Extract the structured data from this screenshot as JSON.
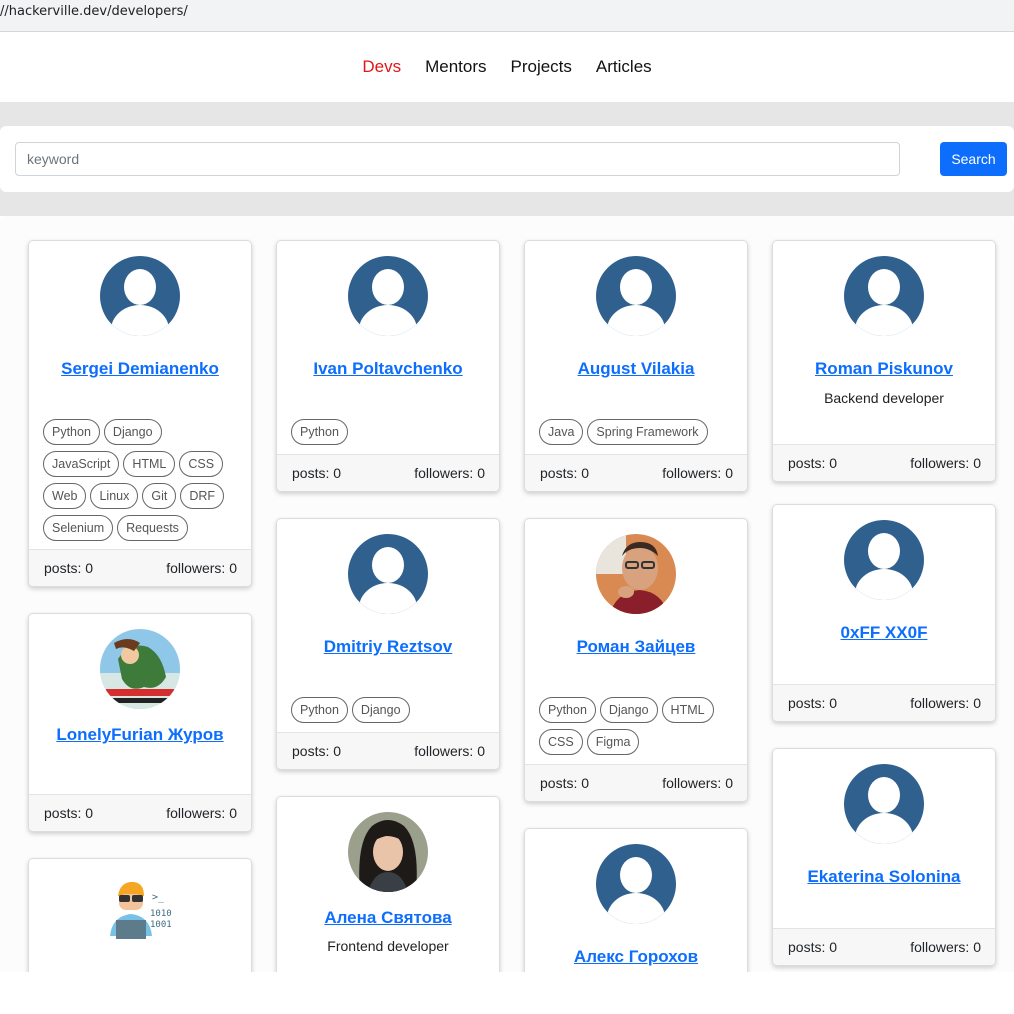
{
  "browser": {
    "url": "//hackerville.dev/developers/"
  },
  "nav": {
    "items": [
      {
        "label": "Devs",
        "active": true
      },
      {
        "label": "Mentors"
      },
      {
        "label": "Projects"
      },
      {
        "label": "Articles"
      }
    ]
  },
  "search": {
    "placeholder": "keyword",
    "button_label": "Search"
  },
  "colors": {
    "accent": "#0d6efd",
    "active_nav": "#e0161a",
    "default_avatar": "#30608e"
  },
  "developers": [
    {
      "name": "Sergei Demianenko",
      "bio": "",
      "tags": [
        "Python",
        "Django",
        "JavaScript",
        "HTML",
        "CSS",
        "Web",
        "Linux",
        "Git",
        "DRF",
        "Selenium",
        "Requests"
      ],
      "posts": "posts: 0",
      "followers": "followers: 0",
      "avatar": "default-avatar-icon"
    },
    {
      "name": "LonelyFurian Журов",
      "bio": "",
      "tags": [],
      "posts": "posts: 0",
      "followers": "followers: 0",
      "avatar": "poster-photo"
    },
    {
      "name": "",
      "bio": "",
      "tags": [],
      "avatar": "programmer-cartoon-icon"
    },
    {
      "name": "Ivan Poltavchenko",
      "bio": "",
      "tags": [
        "Python"
      ],
      "posts": "posts: 0",
      "followers": "followers: 0",
      "avatar": "default-avatar-icon"
    },
    {
      "name": "Dmitriy Reztsov",
      "bio": "",
      "tags": [
        "Python",
        "Django"
      ],
      "posts": "posts: 0",
      "followers": "followers: 0",
      "avatar": "default-avatar-icon"
    },
    {
      "name": "Алена Святова",
      "bio": "Frontend developer",
      "tags": [],
      "avatar": "woman-photo"
    },
    {
      "name": "August Vilakia",
      "bio": "",
      "tags": [
        "Java",
        "Spring Framework"
      ],
      "posts": "posts: 0",
      "followers": "followers: 0",
      "avatar": "default-avatar-icon"
    },
    {
      "name": "Роман Зайцев",
      "bio": "",
      "tags": [
        "Python",
        "Django",
        "HTML",
        "CSS",
        "Figma"
      ],
      "posts": "posts: 0",
      "followers": "followers: 0",
      "avatar": "man-photo"
    },
    {
      "name": "Алекс Горохов",
      "bio": "",
      "tags": [],
      "avatar": "default-avatar-icon"
    },
    {
      "name": "Roman Piskunov",
      "bio": "Backend developer",
      "tags": [],
      "posts": "posts: 0",
      "followers": "followers: 0",
      "avatar": "default-avatar-icon"
    },
    {
      "name": "0xFF XX0F",
      "bio": "",
      "tags": [],
      "posts": "posts: 0",
      "followers": "followers: 0",
      "avatar": "default-avatar-icon"
    },
    {
      "name": "Ekaterina Solonina",
      "bio": "",
      "tags": [],
      "posts": "posts: 0",
      "followers": "followers: 0",
      "avatar": "default-avatar-icon"
    }
  ]
}
